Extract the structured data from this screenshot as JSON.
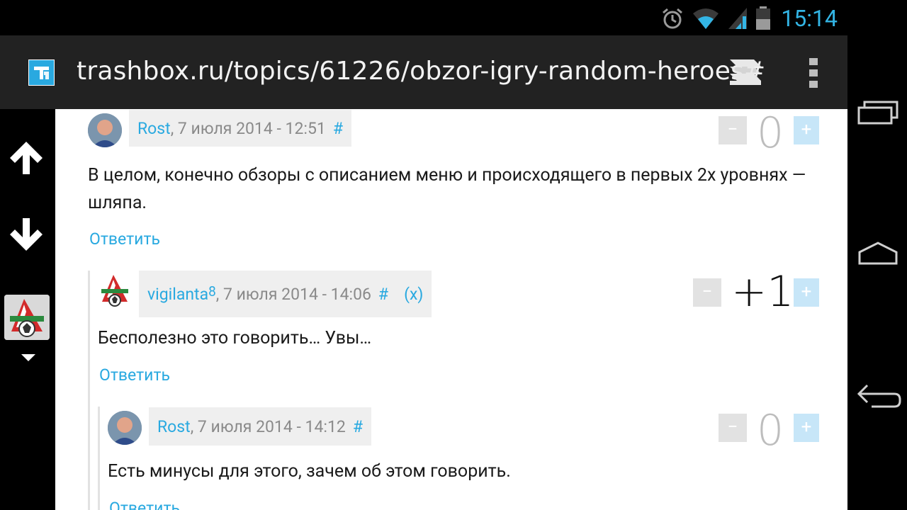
{
  "status": {
    "time": "15:14"
  },
  "browser": {
    "url": "trashbox.ru/topics/61226/obzor-igry-random-heroes#"
  },
  "comments": [
    {
      "author": "Rost",
      "date": ", 7 июля 2014 - 12:51",
      "hash": "#",
      "text": "В целом, конечно обзоры с описанием меню и происходящего в первых 2х уровнях — шляпа.",
      "reply": "Ответить",
      "score": "0",
      "minus": "−",
      "plus": "+"
    },
    {
      "author": "vigilanta",
      "badge": "8",
      "date": ", 7 июля 2014 - 14:06",
      "hash": "#",
      "x": "(x)",
      "text": "Бесполезно это говорить… Увы…",
      "reply": "Ответить",
      "score": "+1",
      "minus": "−",
      "plus": "+"
    },
    {
      "author": "Rost",
      "date": ", 7 июля 2014 - 14:12",
      "hash": "#",
      "text": "Есть минусы для этого, зачем об этом говорить.",
      "reply": "Ответить",
      "score": "0",
      "minus": "−",
      "plus": "+"
    }
  ],
  "colors": {
    "accent": "#29a9e0",
    "status_accent": "#33b5e5"
  }
}
